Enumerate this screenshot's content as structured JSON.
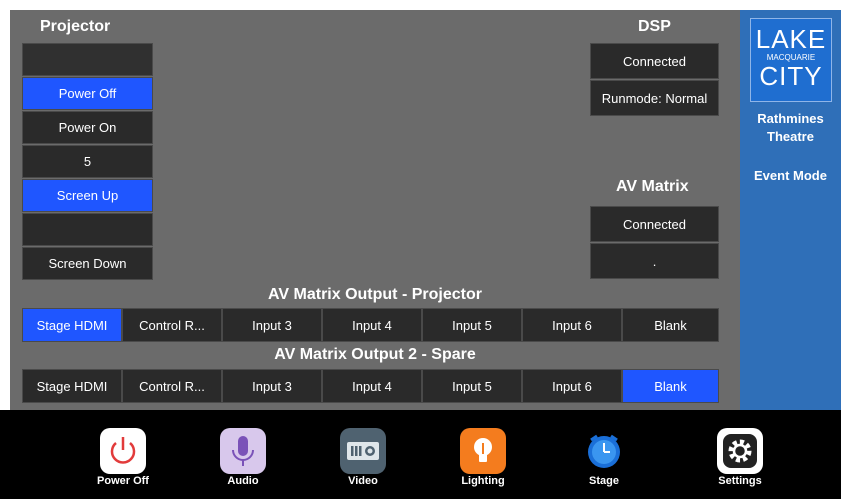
{
  "projector": {
    "title": "Projector",
    "buttons": [
      {
        "label": "",
        "active": false
      },
      {
        "label": "Power Off",
        "active": true
      },
      {
        "label": "Power On",
        "active": false
      },
      {
        "label": "5",
        "active": false
      },
      {
        "label": "Screen Up",
        "active": true
      },
      {
        "label": "",
        "active": false
      },
      {
        "label": "Screen Down",
        "active": false
      }
    ]
  },
  "dsp": {
    "title": "DSP",
    "status": "Connected",
    "runmode": "Runmode: Normal"
  },
  "av_matrix": {
    "title": "AV Matrix",
    "status": "Connected",
    "value": "."
  },
  "output1": {
    "title": "AV Matrix Output - Projector",
    "selected_index": 0,
    "inputs": [
      "Stage HDMI",
      "Control R...",
      "Input 3",
      "Input 4",
      "Input 5",
      "Input 6",
      "Blank"
    ]
  },
  "output2": {
    "title": "AV Matrix Output 2 - Spare",
    "selected_index": 6,
    "inputs": [
      "Stage HDMI",
      "Control R...",
      "Input 3",
      "Input 4",
      "Input 5",
      "Input 6",
      "Blank"
    ]
  },
  "sidebar": {
    "logo_line1": "LAKE",
    "logo_line2": "MACQUARIE",
    "logo_line3": "CITY",
    "venue_line1": "Rathmines",
    "venue_line2": "Theatre",
    "mode": "Event Mode"
  },
  "nav": [
    {
      "label": "Power Off",
      "icon": "power-icon"
    },
    {
      "label": "Audio",
      "icon": "microphone-icon"
    },
    {
      "label": "Video",
      "icon": "projector-icon"
    },
    {
      "label": "Lighting",
      "icon": "lightbulb-icon"
    },
    {
      "label": "Stage",
      "icon": "stage-icon"
    },
    {
      "label": "Settings",
      "icon": "gear-icon"
    }
  ],
  "colors": {
    "active": "#1f56ff",
    "panel": "#6b6b6b",
    "sidebar": "#2f6fb8"
  }
}
